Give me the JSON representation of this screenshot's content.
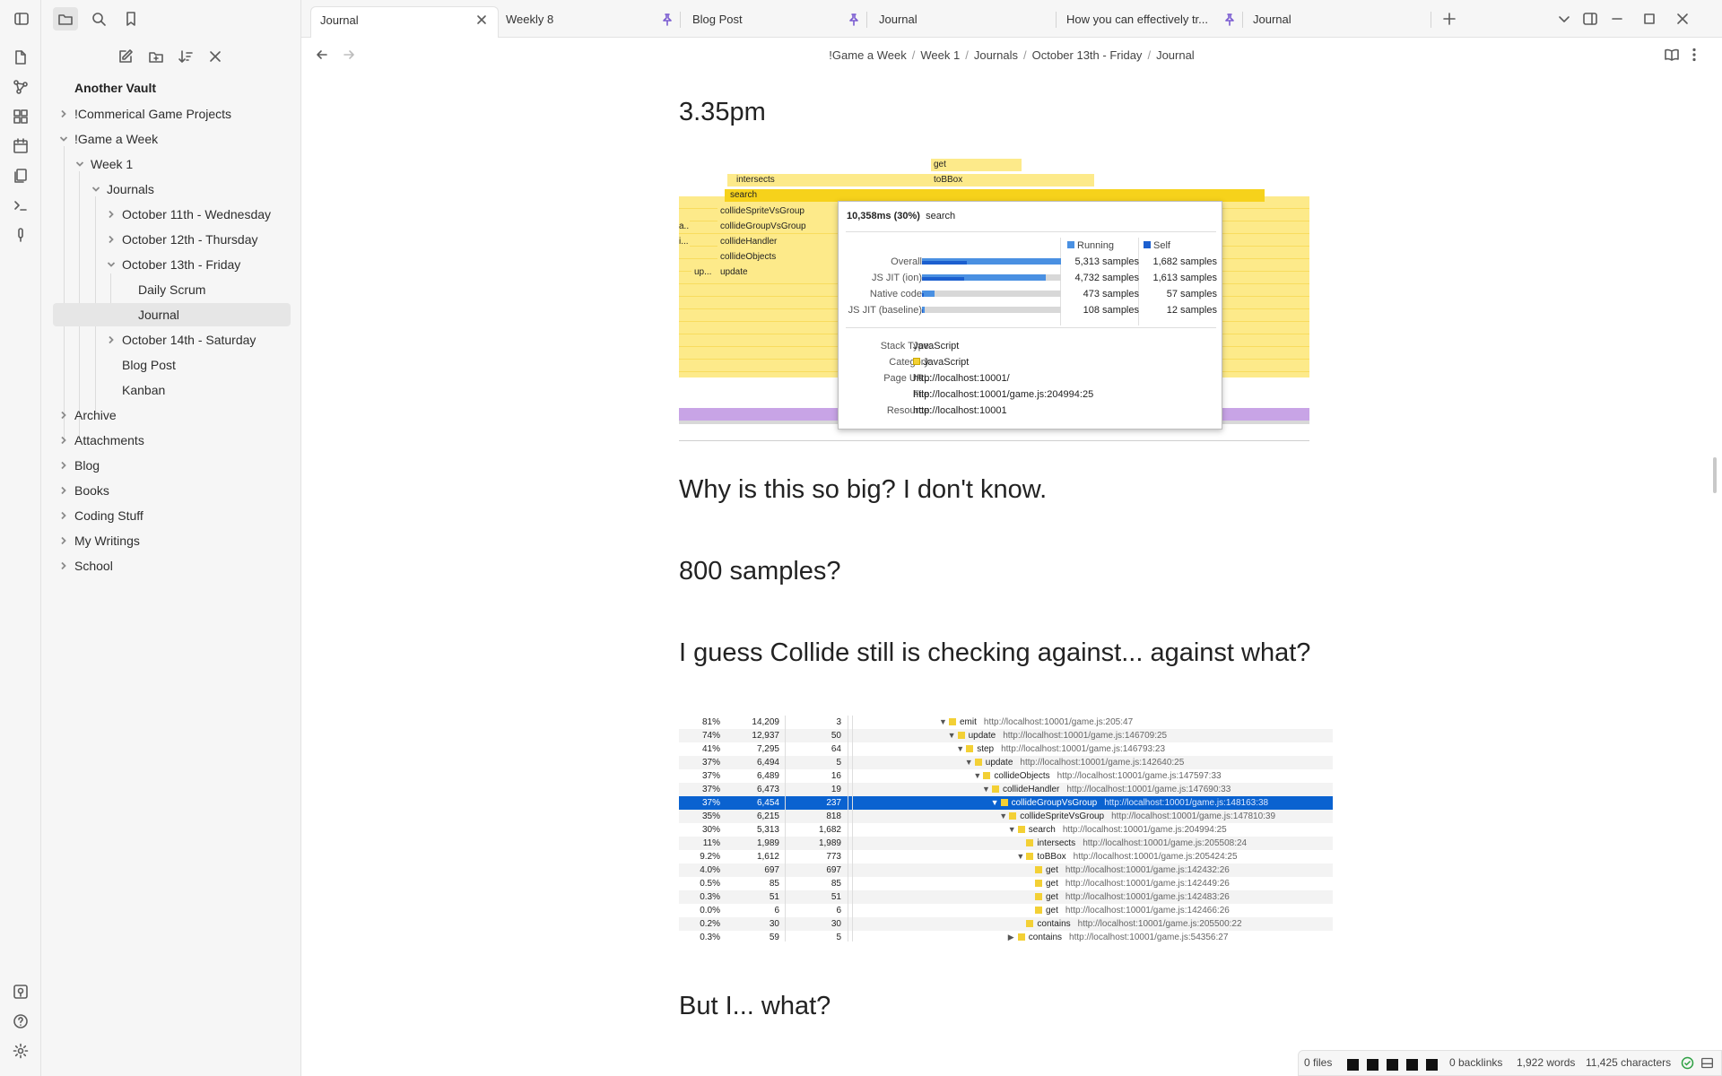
{
  "vault_name": "Another Vault",
  "file_tree": [
    {
      "label": "!Commerical Game Projects"
    },
    {
      "label": "!Game a Week"
    },
    {
      "label": "Week 1"
    },
    {
      "label": "Journals"
    },
    {
      "label": "October 11th - Wednesday"
    },
    {
      "label": "October 12th - Thursday"
    },
    {
      "label": "October 13th - Friday"
    },
    {
      "label": "Daily Scrum"
    },
    {
      "label": "Journal"
    },
    {
      "label": "October 14th - Saturday"
    },
    {
      "label": "Blog Post"
    },
    {
      "label": "Kanban"
    },
    {
      "label": "Archive"
    },
    {
      "label": "Attachments"
    },
    {
      "label": "Blog"
    },
    {
      "label": "Books"
    },
    {
      "label": "Coding Stuff"
    },
    {
      "label": "My Writings"
    },
    {
      "label": "School"
    }
  ],
  "tabs": [
    {
      "label": "Journal"
    },
    {
      "label": "Weekly 8"
    },
    {
      "label": "Blog Post"
    },
    {
      "label": "Journal"
    },
    {
      "label": "How you can effectively tr..."
    },
    {
      "label": "Journal"
    }
  ],
  "breadcrumb": [
    "!Game a Week",
    "Week 1",
    "Journals",
    "October 13th - Friday",
    "Journal"
  ],
  "note": {
    "heading_time": "3.35pm",
    "line1": "Why is this so big? I don't know.",
    "line2": "800 samples?",
    "line3": "I guess Collide still is checking against... against what?",
    "line4": "But I... what?"
  },
  "flame": {
    "blocks": [
      "get",
      "intersects",
      "toBBox",
      "search",
      "collideSpriteVsGroup",
      "collideGroupVsGroup",
      "collideHandler",
      "collideObjects",
      "update",
      "up...",
      "a...",
      "i..."
    ],
    "tooltip": {
      "title_time": "10,358ms (30%)",
      "title_fn": "search",
      "legend_running": "Running",
      "legend_self": "Self",
      "rows": [
        {
          "label": "Overall",
          "running": "5,313 samples",
          "self": "1,682 samples",
          "running_frac": 1.0,
          "self_frac": 0.32
        },
        {
          "label": "JS JIT (ion)",
          "running": "4,732 samples",
          "self": "1,613 samples",
          "running_frac": 0.89,
          "self_frac": 0.3
        },
        {
          "label": "Native code",
          "running": "473 samples",
          "self": "57 samples",
          "running_frac": 0.09,
          "self_frac": 0.01
        },
        {
          "label": "JS JIT (baseline)",
          "running": "108 samples",
          "self": "12 samples",
          "running_frac": 0.02,
          "self_frac": 0.003
        }
      ],
      "details": [
        {
          "k": "Stack Type:",
          "v": "JavaScript"
        },
        {
          "k": "Category:",
          "v": "JavaScript"
        },
        {
          "k": "Page URL:",
          "v": "http://localhost:10001/"
        },
        {
          "k": "File:",
          "v": "http://localhost:10001/game.js:204994:25"
        },
        {
          "k": "Resource:",
          "v": "http://localhost:10001"
        }
      ]
    }
  },
  "calltree": [
    {
      "pct": "81%",
      "total": "14,209",
      "self": "3",
      "fn": "emit",
      "url": "http://localhost:10001/game.js:205:47",
      "depth": 0,
      "tw": "▼"
    },
    {
      "pct": "74%",
      "total": "12,937",
      "self": "50",
      "fn": "update",
      "url": "http://localhost:10001/game.js:146709:25",
      "depth": 1,
      "tw": "▼"
    },
    {
      "pct": "41%",
      "total": "7,295",
      "self": "64",
      "fn": "step",
      "url": "http://localhost:10001/game.js:146793:23",
      "depth": 2,
      "tw": "▼"
    },
    {
      "pct": "37%",
      "total": "6,494",
      "self": "5",
      "fn": "update",
      "url": "http://localhost:10001/game.js:142640:25",
      "depth": 3,
      "tw": "▼"
    },
    {
      "pct": "37%",
      "total": "6,489",
      "self": "16",
      "fn": "collideObjects",
      "url": "http://localhost:10001/game.js:147597:33",
      "depth": 4,
      "tw": "▼"
    },
    {
      "pct": "37%",
      "total": "6,473",
      "self": "19",
      "fn": "collideHandler",
      "url": "http://localhost:10001/game.js:147690:33",
      "depth": 5,
      "tw": "▼"
    },
    {
      "pct": "37%",
      "total": "6,454",
      "self": "237",
      "fn": "collideGroupVsGroup",
      "url": "http://localhost:10001/game.js:148163:38",
      "depth": 6,
      "tw": "▼",
      "selected": true
    },
    {
      "pct": "35%",
      "total": "6,215",
      "self": "818",
      "fn": "collideSpriteVsGroup",
      "url": "http://localhost:10001/game.js:147810:39",
      "depth": 7,
      "tw": "▼"
    },
    {
      "pct": "30%",
      "total": "5,313",
      "self": "1,682",
      "fn": "search",
      "url": "http://localhost:10001/game.js:204994:25",
      "depth": 8,
      "tw": "▼"
    },
    {
      "pct": "11%",
      "total": "1,989",
      "self": "1,989",
      "fn": "intersects",
      "url": "http://localhost:10001/game.js:205508:24",
      "depth": 9,
      "tw": ""
    },
    {
      "pct": "9.2%",
      "total": "1,612",
      "self": "773",
      "fn": "toBBox",
      "url": "http://localhost:10001/game.js:205424:25",
      "depth": 9,
      "tw": "▼"
    },
    {
      "pct": "4.0%",
      "total": "697",
      "self": "697",
      "fn": "get",
      "url": "http://localhost:10001/game.js:142432:26",
      "depth": 10,
      "tw": ""
    },
    {
      "pct": "0.5%",
      "total": "85",
      "self": "85",
      "fn": "get",
      "url": "http://localhost:10001/game.js:142449:26",
      "depth": 10,
      "tw": ""
    },
    {
      "pct": "0.3%",
      "total": "51",
      "self": "51",
      "fn": "get",
      "url": "http://localhost:10001/game.js:142483:26",
      "depth": 10,
      "tw": ""
    },
    {
      "pct": "0.0%",
      "total": "6",
      "self": "6",
      "fn": "get",
      "url": "http://localhost:10001/game.js:142466:26",
      "depth": 10,
      "tw": ""
    },
    {
      "pct": "0.2%",
      "total": "30",
      "self": "30",
      "fn": "contains",
      "url": "http://localhost:10001/game.js:205500:22",
      "depth": 9,
      "tw": ""
    },
    {
      "pct": "0.3%",
      "total": "59",
      "self": "5",
      "fn": "contains",
      "url": "http://localhost:10001/game.js:54356:27",
      "depth": 8,
      "tw": "▶"
    }
  ],
  "status": {
    "files": "0 files",
    "backlinks": "0 backlinks",
    "words": "1,922 words",
    "characters": "11,425 characters"
  },
  "colors": {
    "accent": "#0a62d0",
    "flame_yellow": "#fdea8a",
    "flame_selected": "#f6d21b",
    "flame_purple": "#c8a4e6"
  }
}
